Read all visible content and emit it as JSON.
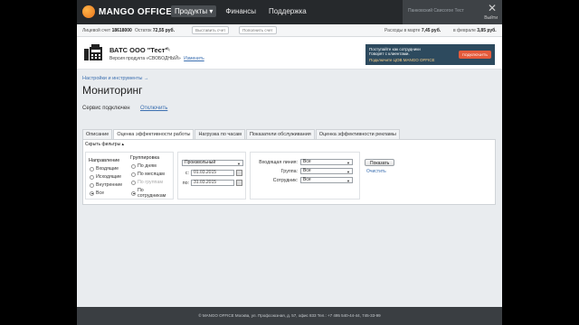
{
  "brand": {
    "logo_text": "MANGO OFFICE"
  },
  "nav": {
    "items": [
      {
        "label": "Продукты ▾"
      },
      {
        "label": "Финансы"
      },
      {
        "label": "Поддержка"
      }
    ]
  },
  "user": {
    "name": "Панковский Свисогое Тест",
    "exit": "Выйти"
  },
  "account": {
    "personal_label": "Лицевой счет",
    "personal_value": "18618000",
    "balance_label": "Остаток",
    "balance_value": "72,55 руб.",
    "invoice_button": "Выставить счет",
    "topup_button": "Пополнить счет",
    "march_label": "Расходы в марте",
    "march_value": "7,45 руб.",
    "feb_label": "в феврале",
    "feb_value": "3,85 руб."
  },
  "company": {
    "name": "ВАТС ООО \"Тест\"",
    "version_text": "Версия продукта «СВОБОДНЫЙ»",
    "change_link": "Изменить"
  },
  "promo": {
    "line1": "Поступайте как сотрудники Говорят с клиентами.",
    "line2": "Подключите ЦОВ MANGO OFFICE",
    "button": "ПОДКЛЮЧИТЬ"
  },
  "breadcrumb": "Настройки и инструменты →",
  "page_title": "Мониторинг",
  "service": {
    "status": "Сервис подключен",
    "disable_link": "Отключить"
  },
  "tabs": [
    {
      "label": "Описание"
    },
    {
      "label": "Оценка эффективности работы"
    },
    {
      "label": "Нагрузка по часам"
    },
    {
      "label": "Показатели обслуживания"
    },
    {
      "label": "Оценка эффективности рекламы"
    }
  ],
  "filters": {
    "toggle_label": "Скрыть фильтры ▴",
    "direction": {
      "heading": "Направление",
      "options": [
        {
          "label": "Входящие"
        },
        {
          "label": "Исходящие"
        },
        {
          "label": "Внутренние"
        },
        {
          "label": "Все"
        }
      ]
    },
    "grouping": {
      "heading": "Группировка",
      "options": [
        {
          "label": "По дням"
        },
        {
          "label": "По месяцам"
        },
        {
          "label": "По группам"
        },
        {
          "label": "По сотрудникам"
        }
      ]
    },
    "period": {
      "selected": "Произвольный",
      "from_label": "с:",
      "from_value": "01.03.2015",
      "to_label": "по:",
      "to_value": "31.03.2015"
    },
    "incoming_line": {
      "label": "Входящая линия:",
      "value": "Все"
    },
    "group": {
      "label": "Группа:",
      "value": "Все"
    },
    "employee": {
      "label": "Сотрудник:",
      "value": "Все"
    },
    "show_button": "Показать",
    "clear_link": "Очистить"
  },
  "footer": "© MANGO OFFICE Москва, ул. Профсоюзная, д. 57, офис 833 Тел.: +7 495 540-44-44, 745-33-99",
  "colors": {
    "topbar": "#26292c",
    "link": "#3b6fb0",
    "promo": "#2d4a5e",
    "promo_button": "#e55b3c",
    "logo": "#e8741c"
  }
}
